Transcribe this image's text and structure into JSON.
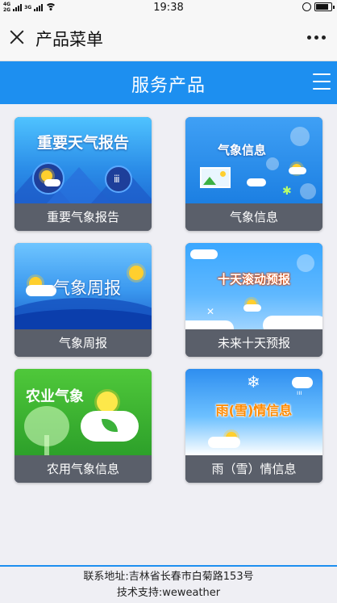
{
  "status_bar": {
    "network_top": "4G",
    "network_bottom": "2G",
    "network_mid": "3G",
    "time": "19:38"
  },
  "nav": {
    "title": "产品菜单"
  },
  "header": {
    "title": "服务产品"
  },
  "cards": [
    {
      "image_title": "重要天气报告",
      "label": "重要气象报告"
    },
    {
      "image_title": "气象信息",
      "label": "气象信息"
    },
    {
      "image_title": "气象周报",
      "label": "气象周报"
    },
    {
      "image_title": "十天滚动预报",
      "label": "未来十天预报"
    },
    {
      "image_title": "农业气象",
      "label": "农用气象信息"
    },
    {
      "image_title": "雨(雪)情信息",
      "label": "雨（雪）情信息"
    }
  ],
  "footer": {
    "address": "联系地址:吉林省长春市白菊路153号",
    "support": "技术支持:weweather"
  },
  "colors": {
    "accent": "#1d8ff0",
    "card_label_bg": "#5a5f6a"
  }
}
